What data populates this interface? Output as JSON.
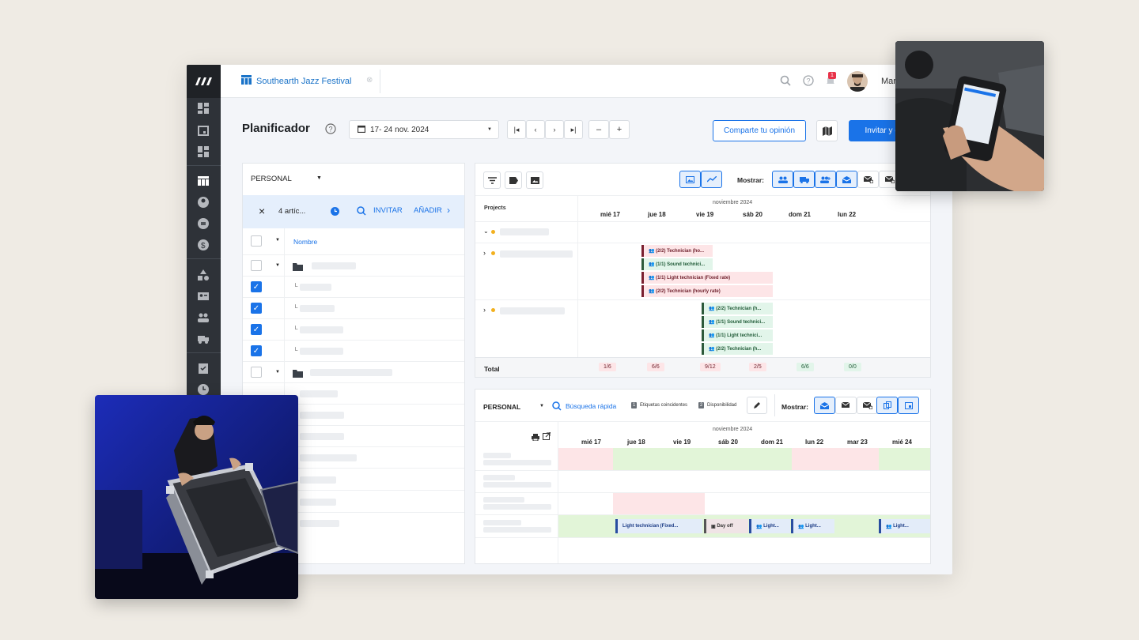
{
  "topbar": {
    "project_name": "Southearth Jazz Festival",
    "notifications": "1",
    "user_name": "Mar"
  },
  "header": {
    "title": "Planificador",
    "date_range": "17- 24 nov. 2024",
    "feedback_btn": "Comparte tu opinión",
    "invite_btn": "Invitar y en"
  },
  "left": {
    "dropdown": "PERSONAL",
    "selection_count": "4 artíc...",
    "invite": "INVITAR",
    "add": "AÑADIR",
    "column_name": "Nombre"
  },
  "gantt": {
    "projects_label": "Projects",
    "month": "noviembre 2024",
    "show_label": "Mostrar:",
    "days": [
      "mié 17",
      "jue 18",
      "vie 19",
      "sáb 20",
      "dom 21",
      "lun 22"
    ],
    "bars1": [
      "(2/2) Technician (ho...",
      "(1/1) Sound technici...",
      "(1/1) Light technician (Fixed rate)",
      "(2/2) Technician (hourly rate)"
    ],
    "bars2": [
      "(2/2) Technician (h...",
      "(1/1) Sound technici...",
      "(1/1) Light technici...",
      "(2/2) Technician (h..."
    ],
    "total_label": "Total",
    "totals": [
      "1/6",
      "6/6",
      "9/12",
      "2/5",
      "6/6",
      "0/0"
    ],
    "colors": {
      "red": "#fde5e7",
      "green": "#e2f5ea",
      "blue": "#e3ecf9"
    }
  },
  "bottom": {
    "dropdown": "PERSONAL",
    "quick_search": "Búsqueda rápida",
    "tag1_num": "1",
    "tag1": "Etiquetas coincidentes",
    "tag2_num": "2",
    "tag2": "Disponibilidad",
    "show_label": "Mostrar:",
    "month": "noviembre 2024",
    "days": [
      "mié 17",
      "jue 18",
      "vie 19",
      "sáb 20",
      "dom 21",
      "lun 22",
      "mar 23",
      "mié 24"
    ],
    "events": [
      "Light technician (Fixed...",
      "Day off",
      "Light...",
      "Light...",
      "Light..."
    ]
  }
}
